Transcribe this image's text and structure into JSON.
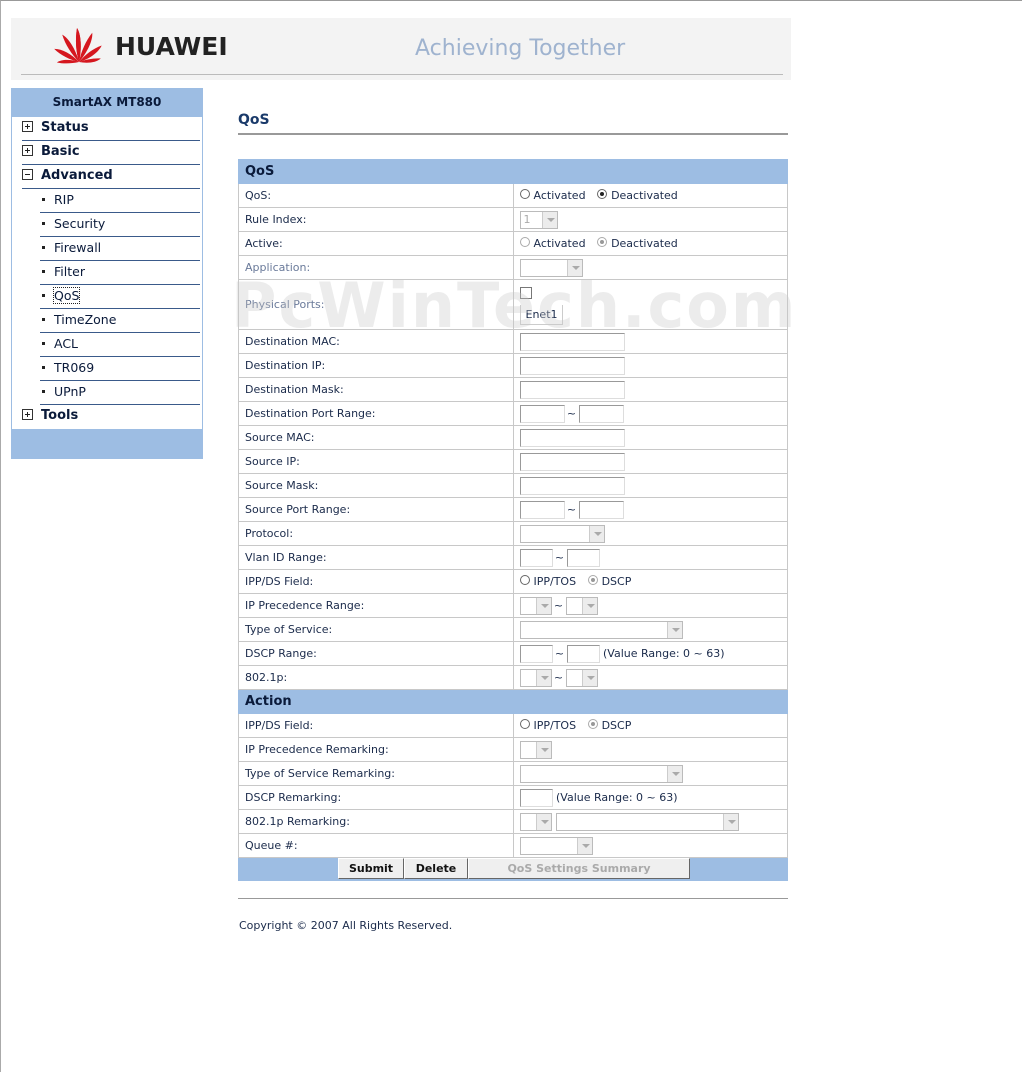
{
  "header": {
    "brand": "HUAWEI",
    "slogan": "Achieving Together",
    "colors": {
      "logo_red": "#d5171f",
      "slogan": "#9fb3cf",
      "accent": "#9dbde3"
    }
  },
  "sidebar": {
    "device": "SmartAX MT880",
    "items": [
      {
        "label": "Status",
        "type": "top",
        "state": "plus"
      },
      {
        "label": "Basic",
        "type": "top",
        "state": "plus"
      },
      {
        "label": "Advanced",
        "type": "top",
        "state": "minus"
      },
      {
        "label": "RIP",
        "type": "sub"
      },
      {
        "label": "Security",
        "type": "sub"
      },
      {
        "label": "Firewall",
        "type": "sub"
      },
      {
        "label": "Filter",
        "type": "sub"
      },
      {
        "label": "QoS",
        "type": "sub",
        "selected": true
      },
      {
        "label": "TimeZone",
        "type": "sub"
      },
      {
        "label": "ACL",
        "type": "sub"
      },
      {
        "label": "TR069",
        "type": "sub"
      },
      {
        "label": "UPnP",
        "type": "sub"
      },
      {
        "label": "Tools",
        "type": "top",
        "state": "plus"
      }
    ]
  },
  "page": {
    "title": "QoS"
  },
  "form": {
    "section_qos": "QoS",
    "section_action": "Action",
    "radio_activated": "Activated",
    "radio_deactivated": "Deactivated",
    "radio_ipptos": "IPP/TOS",
    "radio_dscp": "DSCP",
    "tilde": "~",
    "value_range": "(Value Range: 0 ~ 63)",
    "labels": {
      "qos": "QoS:",
      "rule_index": "Rule Index:",
      "active": "Active:",
      "application": "Application:",
      "physical_ports": "Physical Ports:",
      "destination_mac": "Destination MAC:",
      "destination_ip": "Destination IP:",
      "destination_mask": "Destination Mask:",
      "destination_port_range": "Destination Port Range:",
      "source_mac": "Source MAC:",
      "source_ip": "Source IP:",
      "source_mask": "Source Mask:",
      "source_port_range": "Source Port Range:",
      "protocol": "Protocol:",
      "vlan_id_range": "Vlan ID Range:",
      "ipp_ds_field": "IPP/DS Field:",
      "ip_precedence_range": "IP Precedence Range:",
      "type_of_service": "Type of Service:",
      "dscp_range": "DSCP Range:",
      "dot1p": "802.1p:",
      "action_ipp_ds_field": "IPP/DS Field:",
      "ip_precedence_remarking": "IP Precedence Remarking:",
      "tos_remarking": "Type of Service Remarking:",
      "dscp_remarking": "DSCP Remarking:",
      "dot1p_remarking": "802.1p Remarking:",
      "queue": "Queue #:"
    },
    "values": {
      "qos_state": "Deactivated",
      "rule_index": "1",
      "active_state": "Deactivated",
      "physical_port_name": "Enet1",
      "ipp_ds_field": "DSCP",
      "action_ipp_ds_field": "DSCP"
    }
  },
  "buttons": {
    "submit": "Submit",
    "delete": "Delete",
    "summary": "QoS Settings Summary"
  },
  "footer": {
    "copyright": "Copyright © 2007 All Rights Reserved."
  },
  "watermark": "PcWinTech.com"
}
